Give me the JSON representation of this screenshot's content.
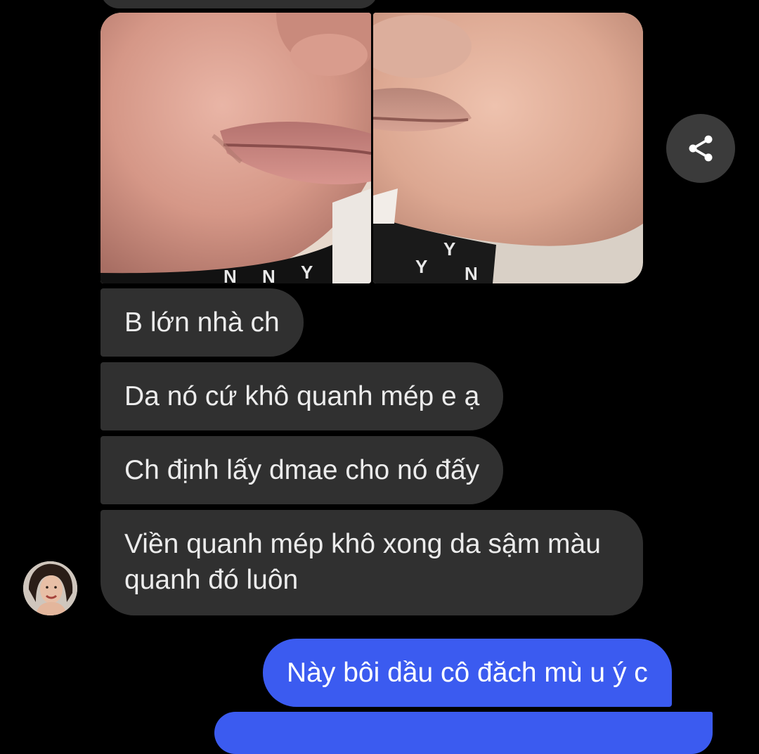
{
  "chat": {
    "incoming_images": [
      {
        "alt": ""
      },
      {
        "alt": ""
      }
    ],
    "share_icon": "share-icon",
    "incoming_messages": [
      {
        "text": "B lớn nhà ch"
      },
      {
        "text": "Da nó cứ khô quanh mép e ạ"
      },
      {
        "text": "Ch định lấy dmae cho nó đấy"
      },
      {
        "text": "Viền quanh mép khô xong da sậm màu quanh đó luôn"
      }
    ],
    "outgoing_messages": [
      {
        "text": "Này bôi dầu cô đăch mù u ý c"
      },
      {
        "text": ""
      }
    ],
    "colors": {
      "background": "#000000",
      "incoming_bubble": "#303030",
      "outgoing_bubble": "#3b5bf0",
      "text": "#ececec"
    }
  }
}
